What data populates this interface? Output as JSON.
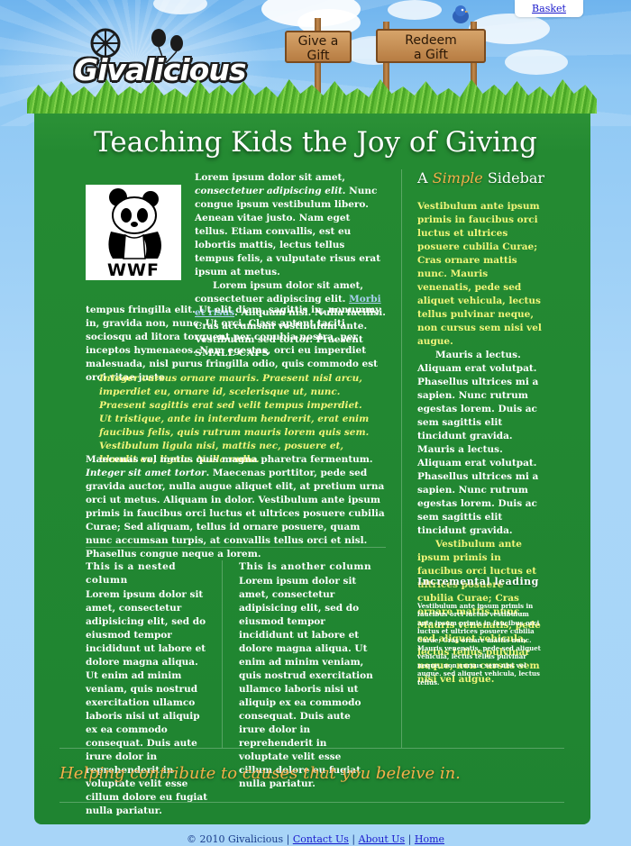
{
  "header": {
    "basket_label": "Basket",
    "logo_text": "Givalicious",
    "nav": [
      {
        "line1": "Give a",
        "line2": "Gift"
      },
      {
        "line1": "Redeem",
        "line2": "a Gift"
      }
    ]
  },
  "main": {
    "title": "Teaching Kids the Joy of Giving",
    "image_label": "WWF",
    "intro": {
      "p1_start": "Lorem ipsum dolor sit amet,",
      "p1_italic": "consectetuer adipiscing elit",
      "p1_rest": ". Nunc congue ipsum vestibulum libero. Aenean vitae justo. Nam eget tellus. Etiam convallis, est eu lobortis mattis, lectus tellus tempus felis, a vulputate risus erat ipsum at metus.",
      "p2_start": "Lorem ipsum dolor sit amet, consectetuer adipiscing elit.",
      "p2_link": "Morbi et risus",
      "p2_mid": ". Aliquam nisl. Nulla facilisi. Cras accumsan vestibulum ante. Vestibulum sed tortor. Praesent",
      "p2_caps": "SMALL CAPS",
      "p2_end": "tempus fringilla elit. Ut elit diam, sagittis in, nonummy in, gravida non, nunc. Ut orci. Class aptent taciti sociosqu ad litora torquent per conubia nostra, per inceptos hymenaeos. Nam egestas, orci eu imperdiet malesuada, nisl purus fringilla odio, quis commodo est orci vitae justo."
    },
    "blockquote": "Integer cursus ornare mauris. Praesent nisl arcu, imperdiet eu, ornare id, scelerisque ut, nunc. Praesent sagittis erat sed velit tempus imperdiet. Ut tristique, ante in interdum hendrerit, erat enim faucibus felis, quis rutrum mauris lorem quis sem. Vestibulum ligula nisi, mattis nec, posuere et, blandit eu, ligula. Nulla nulla.",
    "para3": {
      "start": "Maecenas vel metus quis magna pharetra fermentum.",
      "italic": "Integer sit amet tortor",
      "rest": ". Maecenas porttitor, pede sed gravida auctor, nulla augue aliquet elit, at pretium urna orci ut metus. Aliquam in dolor. Vestibulum ante ipsum primis in faucibus orci luctus et ultrices posuere cubilia Curae; Sed aliquam, tellus id ornare posuere, quam nunc accumsan turpis, at convallis tellus orci et nisl. Phasellus congue neque a lorem."
    },
    "columns": [
      {
        "heading": "This is a nested column",
        "text": "Lorem ipsum dolor sit amet, consectetur adipisicing elit, sed do eiusmod tempor incididunt ut labore et dolore magna aliqua. Ut enim ad minim veniam, quis nostrud exercitation ullamco laboris nisi ut aliquip ex ea commodo consequat. Duis aute irure dolor in reprehenderit in voluptate velit esse cillum dolore eu fugiat nulla pariatur."
      },
      {
        "heading": "This is another column",
        "text": "Lorem ipsum dolor sit amet, consectetur adipisicing elit, sed do eiusmod tempor incididunt ut labore et dolore magna aliqua. Ut enim ad minim veniam, quis nostrud exercitation ullamco laboris nisi ut aliquip ex ea commodo consequat. Duis aute irure dolor in reprehenderit in voluptate velit esse cillum dolore eu fugiat nulla pariatur."
      }
    ]
  },
  "sidebar": {
    "title_a": "A",
    "title_simple": "Simple",
    "title_rest": "Sidebar",
    "p1": "Vestibulum ante ipsum primis in faucibus orci luctus et ultrices posuere cubilia Curae; Cras ornare mattis nunc. Mauris venenatis, pede sed aliquet vehicula, lectus tellus pulvinar neque, non cursus sem nisi vel augue.",
    "p2": "Mauris a lectus. Aliquam erat volutpat. Phasellus ultrices mi a sapien. Nunc rutrum egestas lorem. Duis ac sem sagittis elit tincidunt gravida. Mauris a lectus. Aliquam erat volutpat. Phasellus ultrices mi a sapien. Nunc rutrum egestas lorem. Duis ac sem sagittis elit tincidunt gravida.",
    "p3": "Vestibulum ante ipsum primis in faucibus orci luctus et ultrices posuere cubilia Curae; Cras ornare mattis nunc. Mauris venenatis, pede sed aliquet vehicula, lectus tellus pulvinar neque, non cursus sem nisi vel augue.",
    "incremental_heading": "Incremental leading",
    "incremental_text": "Vestibulum ante ipsum primis in faucibus orci luctus vestibulum ante ipsum primis in faucibus orci luctus et ultrices posuere cubilia Curae; Cras ornare mattis nunc. Mauris venenatis, pede sed aliquet vehicula, lectus tellus pulvinar neque, non cursus sem nisi vel augue. sed aliquet vehicula, lectus tellus."
  },
  "tagline": "Helping contribute to causes that you beleive in.",
  "footer": {
    "copyright": "© 2010 Givalicious",
    "sep": "|",
    "links": [
      "Contact Us",
      "About Us",
      "Home"
    ]
  },
  "colors": {
    "accent": "#f4b04a",
    "highlight": "#f2f57a",
    "panel": "#248a32",
    "link": "#1a1acc"
  }
}
